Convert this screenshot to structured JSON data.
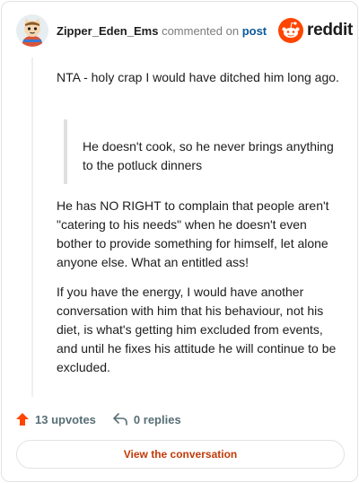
{
  "comment": {
    "author": "Zipper_Eden_Ems",
    "action_text": "commented on",
    "post_link": "post",
    "paragraph_1": "NTA - holy crap I would have ditched him long ago.",
    "quote": "He doesn't cook, so he never brings anything to the potluck dinners",
    "paragraph_2": "He has NO RIGHT to complain that people aren't \"catering to his needs\" when he doesn't even bother to provide something for himself, let alone anyone else. What an entitled ass!",
    "paragraph_3": "If you have the energy, I would have another conversation with him that his behaviour, not his diet, is what's getting him excluded from events, and until he fixes his attitude he will continue to be excluded."
  },
  "brand": {
    "wordmark": "reddit",
    "color": "#ff4500"
  },
  "footer": {
    "upvotes": "13 upvotes",
    "replies": "0 replies",
    "upvote_icon": "upvote-arrow-icon",
    "reply_icon": "reply-arrow-icon"
  },
  "cta": {
    "label": "View the conversation",
    "color": "#c23a08"
  }
}
